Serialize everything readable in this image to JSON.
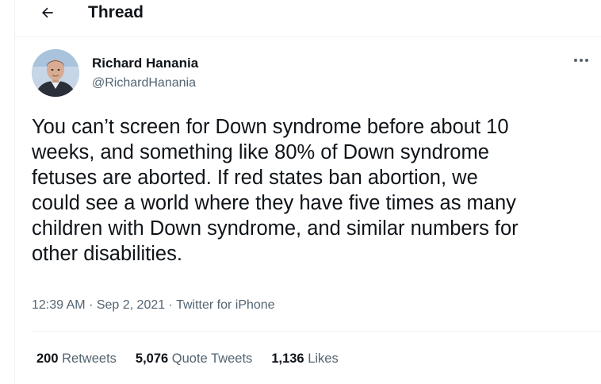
{
  "header": {
    "back_icon": "arrow-left-icon",
    "title": "Thread"
  },
  "tweet": {
    "author": {
      "name": "Richard Hanania",
      "handle": "@RichardHanania",
      "avatar_icon": "avatar-photo"
    },
    "more_icon": "more-horizontal-icon",
    "text": "You can’t screen for Down syndrome before about 10\nweeks, and something like 80% of Down syndrome\nfetuses are aborted. If red states ban abortion, we\ncould see a world where they have five times as many\nchildren with Down syndrome, and similar numbers for\nother disabilities.",
    "time": "12:39 AM",
    "separator": "·",
    "date": "Sep 2, 2021",
    "source": "Twitter for iPhone",
    "stats": {
      "retweets_count": "200",
      "retweets_label": "Retweets",
      "quotes_count": "5,076",
      "quotes_label": "Quote Tweets",
      "likes_count": "1,136",
      "likes_label": "Likes"
    }
  },
  "colors": {
    "text": "#0f1419",
    "secondary": "#536471",
    "divider": "#eff3f4"
  }
}
